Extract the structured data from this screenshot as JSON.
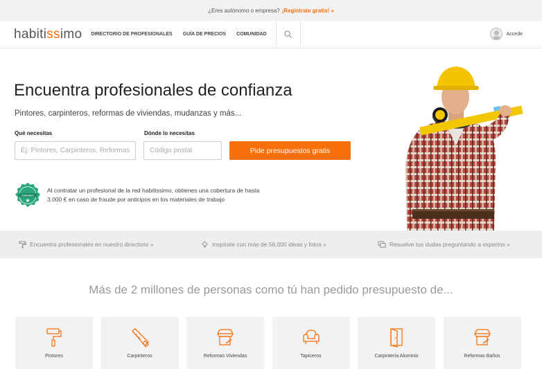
{
  "topbar": {
    "question": "¿Eres autónomo o empresa?",
    "cta": "¡Regístrate gratis! »"
  },
  "nav": {
    "logo_part1": "habiti",
    "logo_part2": "ss",
    "logo_part3": "imo",
    "items": [
      "DIRECTORIO DE PROFESIONALES",
      "GUÍA DE PRECIOS",
      "COMUNIDAD"
    ],
    "login_label": "Accede"
  },
  "hero": {
    "title": "Encuentra profesionales de confianza",
    "subtitle": "Pintores, carpinteros, reformas de viviendas, mudanzas y más...",
    "what_label": "Qué necesitas",
    "what_placeholder": "Ej: Pintores, Carpinteros, Reformas",
    "where_label": "Dónde lo necesitas",
    "where_placeholder": "Código postal",
    "button_label": "Pide presupuestos gratis",
    "badge_text": "CONFIANZA",
    "guarantee_text": "Al contratar un profesional de la red habitissimo, obtienes una cobertura de hasta 3.000 € en caso de fraude por anticipos en los materiales de trabajo"
  },
  "strip": {
    "items": [
      "Encuentra profesionales en nuestro directorio »",
      "Inspírate con más de 56.000 ideas y fotos »",
      "Resuelve tus dudas preguntando a expertos »"
    ]
  },
  "headline": "Más de 2 millones de personas como tú han pedido presupuesto de...",
  "categories": [
    {
      "label": "Pintores",
      "icon": "paint-roller-icon"
    },
    {
      "label": "Carpinteros",
      "icon": "saw-icon"
    },
    {
      "label": "Reformas Viviendas",
      "icon": "shop-renovation-icon"
    },
    {
      "label": "Tapiceros",
      "icon": "armchair-icon"
    },
    {
      "label": "Carpintería Aluminio",
      "icon": "door-icon"
    },
    {
      "label": "Reformas Baños",
      "icon": "shop-renovation-icon"
    }
  ],
  "colors": {
    "accent": "#f7700c",
    "strip_bg": "#eeeeee",
    "card_bg": "#f2f2f2",
    "badge": "#2aa57c"
  }
}
